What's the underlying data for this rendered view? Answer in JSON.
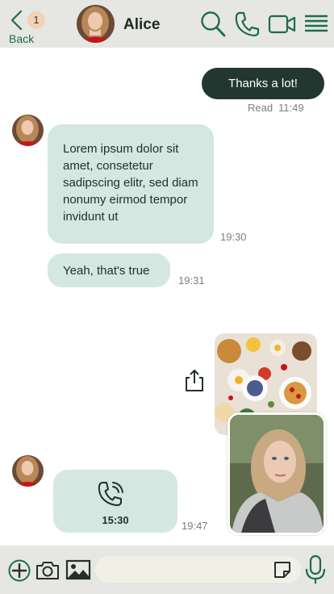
{
  "header": {
    "back_label": "Back",
    "unread_count": "1",
    "contact_name": "Alice"
  },
  "icons": {
    "back": "chevron-left-icon",
    "search": "search-icon",
    "phone": "phone-icon",
    "video": "video-camera-icon",
    "menu": "hamburger-menu-icon",
    "share": "share-icon",
    "phone_call": "phone-call-icon",
    "add": "plus-icon",
    "camera": "camera-icon",
    "gallery": "image-icon",
    "sticker": "sticker-icon",
    "mic": "microphone-icon"
  },
  "colors": {
    "header_bg": "#e6e6e4",
    "accent_green": "#1f6b4e",
    "outgoing_bubble": "#22372f",
    "incoming_bubble": "#d4e7e1",
    "badge": "#f3d3b3"
  },
  "messages": {
    "m1_text": "Thanks a lot!",
    "m1_status": "Read",
    "m1_time": "11:49",
    "m2_text": "Lorem ipsum dolor sit amet, consetetur sadipscing elitr, sed diam nonumy eirmod tempor invidunt ut",
    "m2_time": "19:30",
    "m3_text": "Yeah, that's true",
    "m3_time": "19:31",
    "call_duration": "15:30",
    "call_time": "19:47"
  }
}
